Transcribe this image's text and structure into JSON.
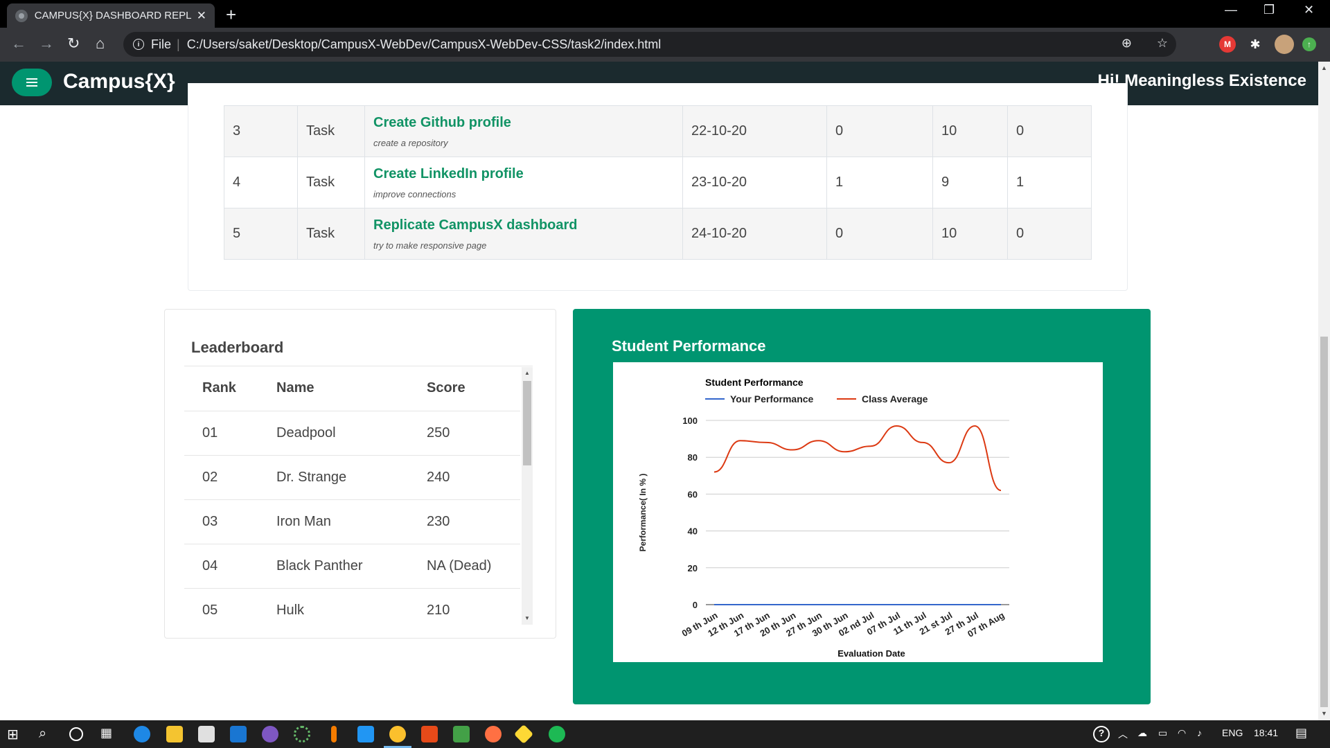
{
  "browser": {
    "tab_title": "CAMPUS{X} DASHBOARD REPLIC",
    "tab_close": "✕",
    "new_tab": "+",
    "window_controls": {
      "minimize": "—",
      "restore": "❐",
      "close": "✕"
    },
    "nav": {
      "back": "←",
      "forward": "→",
      "reload": "↻",
      "home": "⌂"
    },
    "address": {
      "info": "i",
      "scheme": "File",
      "separator": "|",
      "url": "C:/Users/saket/Desktop/CampusX-WebDev/CampusX-WebDev-CSS/task2/index.html"
    },
    "actions": {
      "zoom": "⊕",
      "bookmark": "☆"
    },
    "extensions": [
      {
        "label": "M",
        "color": "#e53935"
      },
      {
        "label": "✱",
        "color": "#35363a"
      },
      {
        "label": "",
        "color": "#c8a27a"
      },
      {
        "label": "↑",
        "color": "#4caf50"
      }
    ]
  },
  "app": {
    "brand": "Campus{X}",
    "greeting": "Hi! Meaningless Existence",
    "accent": "#009570",
    "header_bg": "#1b2a2e"
  },
  "tasks": [
    {
      "num": "3",
      "type": "Task",
      "title": "Create Github profile",
      "subtitle": "create a repository",
      "date": "22-10-20",
      "c1": "0",
      "c2": "10",
      "c3": "0"
    },
    {
      "num": "4",
      "type": "Task",
      "title": "Create LinkedIn profile",
      "subtitle": "improve connections",
      "date": "23-10-20",
      "c1": "1",
      "c2": "9",
      "c3": "1"
    },
    {
      "num": "5",
      "type": "Task",
      "title": "Replicate CampusX dashboard",
      "subtitle": "try to make responsive page",
      "date": "24-10-20",
      "c1": "0",
      "c2": "10",
      "c3": "0"
    }
  ],
  "leaderboard": {
    "heading": "Leaderboard",
    "headers": {
      "rank": "Rank",
      "name": "Name",
      "score": "Score"
    },
    "rows": [
      {
        "rank": "01",
        "name": "Deadpool",
        "score": "250"
      },
      {
        "rank": "02",
        "name": "Dr. Strange",
        "score": "240"
      },
      {
        "rank": "03",
        "name": "Iron Man",
        "score": "230"
      },
      {
        "rank": "04",
        "name": "Black Panther",
        "score": "NA (Dead)"
      },
      {
        "rank": "05",
        "name": "Hulk",
        "score": "210"
      }
    ]
  },
  "performance": {
    "heading": "Student Performance"
  },
  "chart_data": {
    "type": "line",
    "title": "Student Performance",
    "xlabel": "Evaluation Date",
    "ylabel": "Performance( In % )",
    "ylim": [
      0,
      100
    ],
    "yticks": [
      "0",
      "20",
      "40",
      "60",
      "80",
      "100"
    ],
    "grid": true,
    "legend": "top",
    "xtick_labels": [
      "09 th Jun",
      "12 th Jun",
      "17 th Jun",
      "20 th Jun",
      "27 th Jun",
      "30 th Jun",
      "02 nd Jul",
      "07 th Jul",
      "11 th Jul",
      "21 st Jul",
      "27 th Jul",
      "07 th Aug"
    ],
    "series": [
      {
        "name": "Your Performance",
        "color": "#3366cc",
        "values": [
          0,
          0,
          0,
          0,
          0,
          0,
          0,
          0,
          0,
          0,
          0,
          0
        ]
      },
      {
        "name": "Class Average",
        "color": "#dc3912",
        "values": [
          72,
          89,
          88,
          84,
          89,
          83,
          86,
          97,
          88,
          77,
          97,
          62
        ]
      }
    ]
  },
  "taskbar": {
    "language": "ENG",
    "time": "18:41"
  }
}
